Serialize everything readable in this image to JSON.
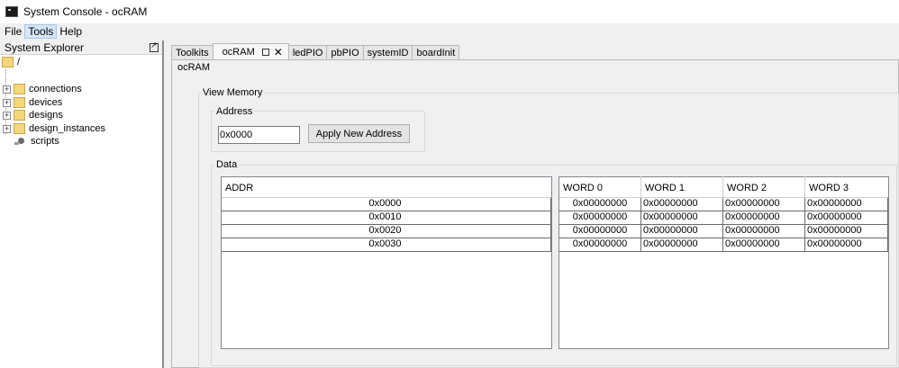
{
  "window": {
    "title": "System Console - ocRAM"
  },
  "menu": {
    "items": [
      "File",
      "Tools",
      "Help"
    ]
  },
  "explorer": {
    "title": "System Explorer",
    "root": "/",
    "items": [
      {
        "label": "connections",
        "kind": "folder",
        "expandable": true
      },
      {
        "label": "devices",
        "kind": "folder",
        "expandable": true
      },
      {
        "label": "designs",
        "kind": "folder",
        "expandable": true
      },
      {
        "label": "design_instances",
        "kind": "folder",
        "expandable": true
      },
      {
        "label": "scripts",
        "kind": "script",
        "expandable": false
      }
    ]
  },
  "tabs": [
    "Toolkits",
    "ocRAM",
    "ledPIO",
    "pbPIO",
    "systemID",
    "boardInit"
  ],
  "active_tab": "ocRAM",
  "panel": {
    "title": "ocRAM",
    "view_memory_label": "View Memory",
    "address_label": "Address",
    "address_value": "0x0000",
    "apply_button": "Apply New Address",
    "data_label": "Data"
  },
  "addr_table": {
    "header": "ADDR",
    "rows": [
      "0x0000",
      "0x0010",
      "0x0020",
      "0x0030"
    ]
  },
  "word_table": {
    "headers": [
      "WORD 0",
      "WORD 1",
      "WORD 2",
      "WORD 3"
    ],
    "rows": [
      [
        "0x00000000",
        "0x00000000",
        "0x00000000",
        "0x00000000"
      ],
      [
        "0x00000000",
        "0x00000000",
        "0x00000000",
        "0x00000000"
      ],
      [
        "0x00000000",
        "0x00000000",
        "0x00000000",
        "0x00000000"
      ],
      [
        "0x00000000",
        "0x00000000",
        "0x00000000",
        "0x00000000"
      ]
    ]
  },
  "icons": {
    "app": "console-icon",
    "float": "float-window-icon",
    "tab_detach": "detach-icon",
    "tab_close": "close-icon"
  }
}
